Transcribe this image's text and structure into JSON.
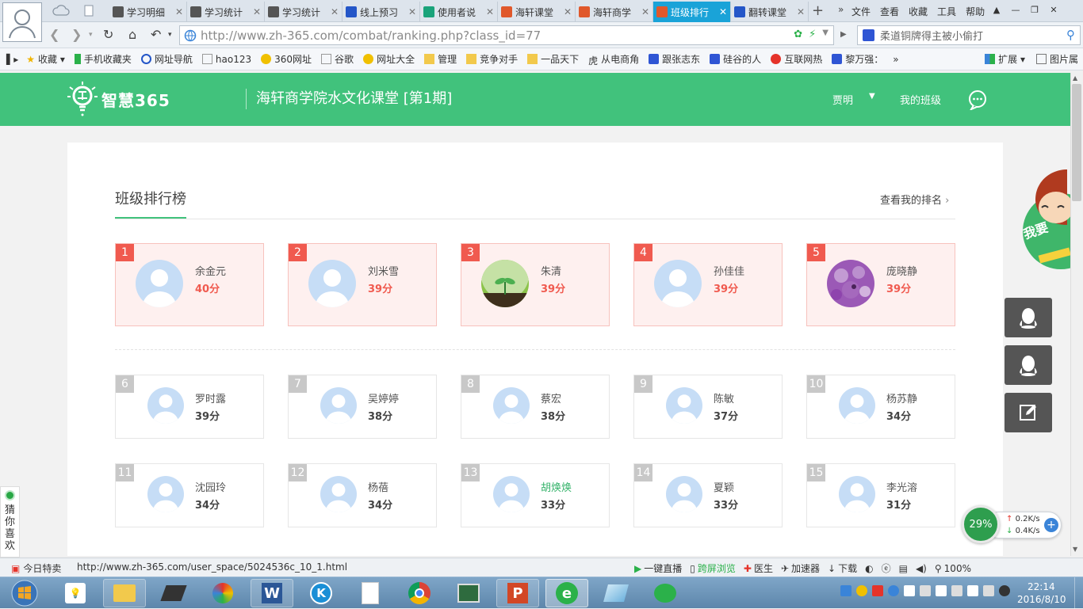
{
  "browser": {
    "tabs": [
      {
        "label": "学习明细",
        "color": "#555"
      },
      {
        "label": "学习统计",
        "color": "#555"
      },
      {
        "label": "学习统计",
        "color": "#555"
      },
      {
        "label": "线上预习",
        "color": "#2456c8"
      },
      {
        "label": "使用者说",
        "color": "#1aa37a"
      },
      {
        "label": "海轩课堂",
        "color": "#e0582b"
      },
      {
        "label": "海轩商学",
        "color": "#e0582b"
      },
      {
        "label": "班级排行",
        "color": "#e0582b"
      },
      {
        "label": "翻转课堂",
        "color": "#2456c8"
      }
    ],
    "active_tab_index": 7,
    "menu_more": "»",
    "menus": [
      "文件",
      "查看",
      "收藏",
      "工具",
      "帮助"
    ],
    "url": "http://www.zh-365.com/combat/ranking.php?class_id=77",
    "search_text": "柔道铜牌得主被小偷打",
    "bookmarks_favorites_label": "收藏",
    "bookmarks": [
      "手机收藏夹",
      "网址导航",
      "hao123",
      "360网址",
      "谷歌",
      "网址大全",
      "管理",
      "竞争对手",
      "一品天下",
      "从电商角",
      "跟张志东",
      "硅谷的人",
      "互联网热",
      "黎万强："
    ],
    "bookmarks_more": "»",
    "extensions_label": "扩展",
    "image_label": "图片属",
    "status_today": "今日特卖",
    "status_url": "http://www.zh-365.com/user_space/5024536c_10_1.html",
    "status_items": [
      "一键直播",
      "跨屏浏览",
      "医生",
      "加速器",
      "下载"
    ],
    "zoom": "100%"
  },
  "site": {
    "logo_text": "智慧365",
    "course_title": "海轩商学院水文化课堂 [第1期]",
    "user_name": "贾明",
    "my_class_label": "我的班级",
    "accent": "#41c27c"
  },
  "ranking": {
    "title": "班级排行榜",
    "view_mine": "查看我的排名",
    "top": [
      {
        "rank": "1",
        "name": "余金元",
        "score": "40分",
        "avatar": "default"
      },
      {
        "rank": "2",
        "name": "刘米雪",
        "score": "39分",
        "avatar": "default"
      },
      {
        "rank": "3",
        "name": "朱清",
        "score": "39分",
        "avatar": "sprout"
      },
      {
        "rank": "4",
        "name": "孙佳佳",
        "score": "39分",
        "avatar": "default"
      },
      {
        "rank": "5",
        "name": "庞晓静",
        "score": "39分",
        "avatar": "flowers"
      }
    ],
    "rows": [
      [
        {
          "rank": "6",
          "name": "罗时露",
          "score": "39分"
        },
        {
          "rank": "7",
          "name": "吴婷婷",
          "score": "38分"
        },
        {
          "rank": "8",
          "name": "蔡宏",
          "score": "38分"
        },
        {
          "rank": "9",
          "name": "陈敏",
          "score": "37分"
        },
        {
          "rank": "10",
          "name": "杨苏静",
          "score": "34分"
        }
      ],
      [
        {
          "rank": "11",
          "name": "沈园玲",
          "score": "34分"
        },
        {
          "rank": "12",
          "name": "杨蓓",
          "score": "34分"
        },
        {
          "rank": "13",
          "name": "胡焕焕",
          "score": "33分",
          "self": true
        },
        {
          "rank": "14",
          "name": "夏颖",
          "score": "33分"
        },
        {
          "rank": "15",
          "name": "李光溶",
          "score": "31分"
        }
      ]
    ]
  },
  "side": {
    "guess_chars": [
      "猜",
      "你",
      "喜",
      "欢"
    ],
    "mascot_text": "我要"
  },
  "netspeed": {
    "percent": "29%",
    "up": "0.2K/s",
    "down": "0.4K/s"
  },
  "taskbar": {
    "time": "22:14",
    "date": "2016/8/10"
  }
}
